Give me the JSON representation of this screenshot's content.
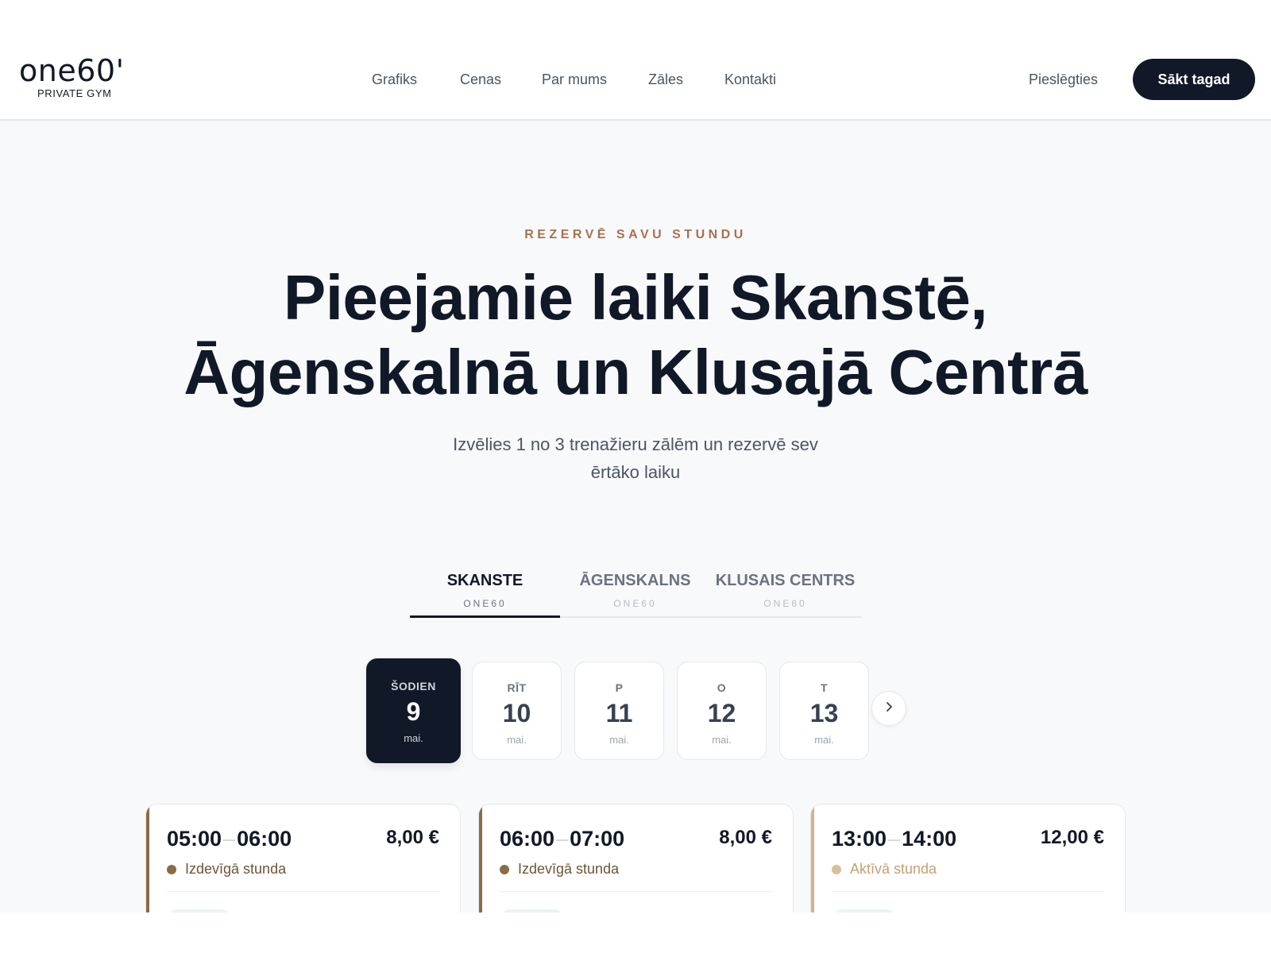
{
  "brand": {
    "name": "one60'",
    "tagline": "PRIVATE GYM"
  },
  "nav": {
    "items": [
      "Grafiks",
      "Cenas",
      "Par mums",
      "Zāles",
      "Kontakti"
    ],
    "login_label": "Pieslēgties",
    "cta_label": "Sākt tagad"
  },
  "hero": {
    "eyebrow": "REZERVĒ SAVU STUNDU",
    "title_line1": "Pieejamie laiki Skanstē,",
    "title_line2": "Āgenskalnā un Klusajā Centrā",
    "subtitle_line1": "Izvēlies 1 no 3 trenažieru zālēm un rezervē sev",
    "subtitle_line2": "ērtāko laiku"
  },
  "locations": [
    {
      "label": "SKANSTE",
      "sub": "ONE60",
      "active": true
    },
    {
      "label": "ĀGENSKALNS",
      "sub": "ONE60",
      "active": false
    },
    {
      "label": "KLUSAIS CENTRS",
      "sub": "ONE60",
      "active": false
    }
  ],
  "days": [
    {
      "name": "ŠODIEN",
      "num": "9",
      "month": "mai.",
      "active": true
    },
    {
      "name": "RĪT",
      "num": "10",
      "month": "mai.",
      "active": false
    },
    {
      "name": "P",
      "num": "11",
      "month": "mai.",
      "active": false
    },
    {
      "name": "O",
      "num": "12",
      "month": "mai.",
      "active": false
    },
    {
      "name": "T",
      "num": "13",
      "month": "mai.",
      "active": false
    }
  ],
  "next_icon": "chevron-right-icon",
  "slots": [
    {
      "start": "05:00",
      "end": "06:00",
      "price": "8,00 €",
      "type": "Izdevīgā stunda",
      "accent": "#8b6c45",
      "type_color": "#6b5638",
      "dot_color": "#8b6c45"
    },
    {
      "start": "06:00",
      "end": "07:00",
      "price": "8,00 €",
      "type": "Izdevīgā stunda",
      "accent": "#8b6c45",
      "type_color": "#6b5638",
      "dot_color": "#8b6c45"
    },
    {
      "start": "13:00",
      "end": "14:00",
      "price": "12,00 €",
      "type": "Aktīvā stunda",
      "accent": "#d2b48c",
      "type_color": "#c4a171",
      "dot_color": "#d9bf99"
    }
  ],
  "colors": {
    "primary": "#111827",
    "accent_brown": "#a9714d",
    "background": "#f8f9fb"
  }
}
